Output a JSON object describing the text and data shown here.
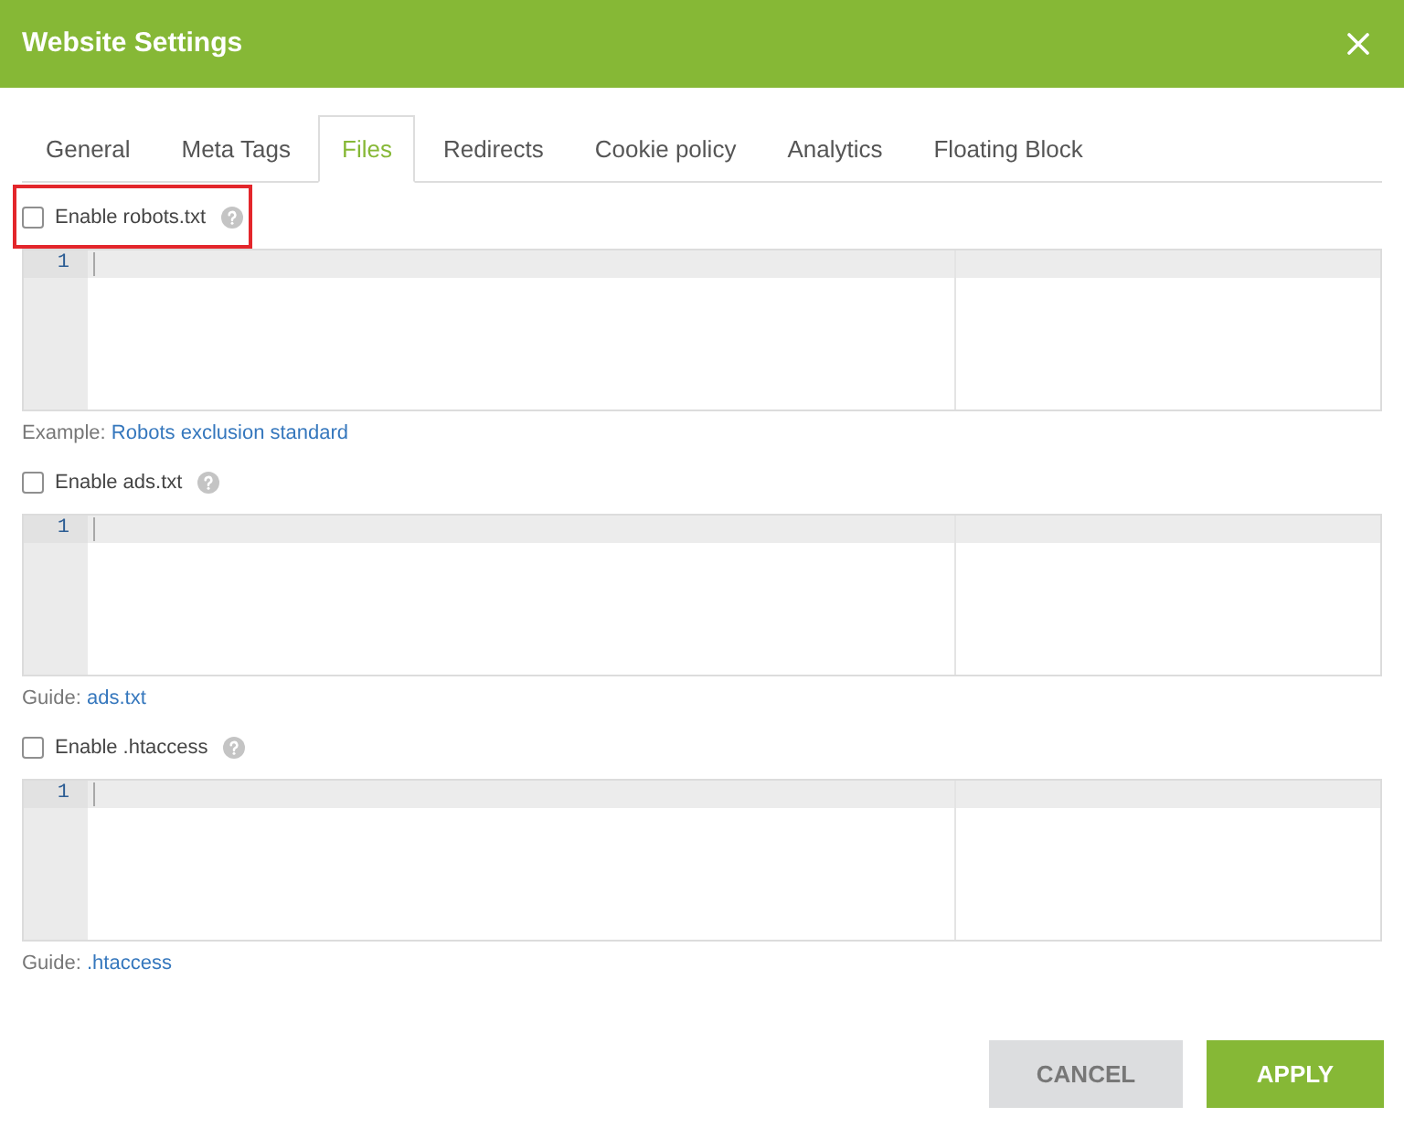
{
  "window": {
    "title": "Website Settings"
  },
  "tabs": [
    {
      "label": "General",
      "selected": false
    },
    {
      "label": "Meta Tags",
      "selected": false
    },
    {
      "label": "Files",
      "selected": true
    },
    {
      "label": "Redirects",
      "selected": false
    },
    {
      "label": "Cookie policy",
      "selected": false
    },
    {
      "label": "Analytics",
      "selected": false
    },
    {
      "label": "Floating Block",
      "selected": false
    }
  ],
  "files": [
    {
      "label": "Enable robots.txt",
      "checked": false,
      "highlighted": true,
      "line_numbers": [
        "1"
      ],
      "note": {
        "text": "Example:",
        "link": "Robots exclusion standard"
      }
    },
    {
      "label": "Enable ads.txt",
      "checked": false,
      "highlighted": false,
      "line_numbers": [
        "1"
      ],
      "note": {
        "text": "Guide:",
        "link": "ads.txt"
      }
    },
    {
      "label": "Enable .htaccess",
      "checked": false,
      "highlighted": false,
      "line_numbers": [
        "1"
      ],
      "note": {
        "text": "Guide:",
        "link": ".htaccess"
      }
    }
  ],
  "buttons": [
    {
      "label": "CANCEL",
      "kind": "secondary"
    },
    {
      "label": "APPLY",
      "kind": "primary"
    }
  ]
}
